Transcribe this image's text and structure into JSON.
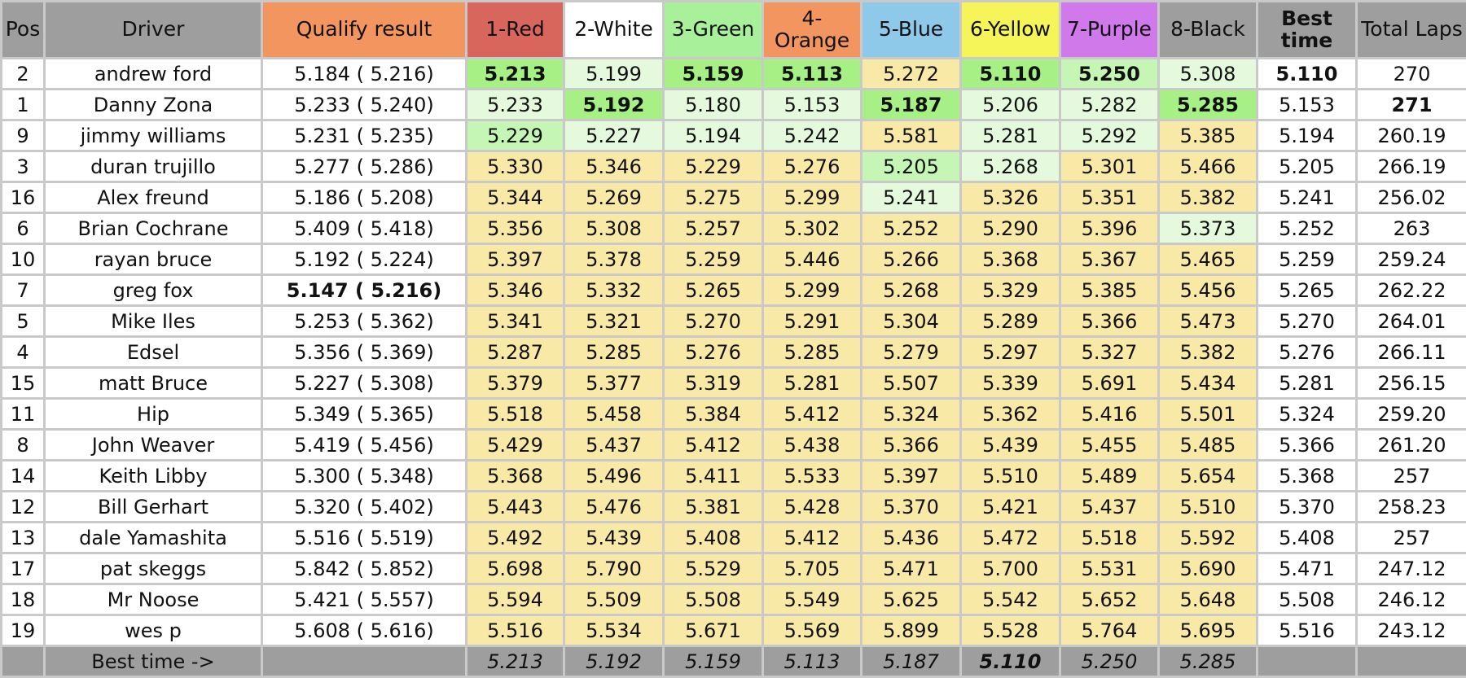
{
  "headers": [
    {
      "key": "pos",
      "label": "Pos",
      "bg": "#9e9e9e"
    },
    {
      "key": "driver",
      "label": "Driver",
      "bg": "#9e9e9e"
    },
    {
      "key": "qualify",
      "label": "Qualify result",
      "bg": "#f3955e"
    },
    {
      "key": "lane1",
      "label": "1-Red",
      "bg": "#d9665c"
    },
    {
      "key": "lane2",
      "label": "2-White",
      "bg": "#ffffff"
    },
    {
      "key": "lane3",
      "label": "3-Green",
      "bg": "#a9f09a"
    },
    {
      "key": "lane4",
      "label": "4-\nOrange",
      "bg": "#f3955e"
    },
    {
      "key": "lane5",
      "label": "5-Blue",
      "bg": "#8ec9ea"
    },
    {
      "key": "lane6",
      "label": "6-Yellow",
      "bg": "#f5f55a"
    },
    {
      "key": "lane7",
      "label": "7-Purple",
      "bg": "#cf79ea"
    },
    {
      "key": "lane8",
      "label": "8-Black",
      "bg": "#9e9e9e"
    },
    {
      "key": "best",
      "label": "Best\ntime",
      "bg": "#9e9e9e",
      "bold": true
    },
    {
      "key": "total",
      "label": "Total Laps",
      "bg": "#9e9e9e"
    }
  ],
  "cell_colors": {
    "y": "#f9e9a6",
    "g": "#a6f086",
    "l": "#c6f6b6",
    "p": "#e5fadc"
  },
  "rows": [
    {
      "pos": "2",
      "driver": "andrew ford",
      "qualify": "5.184 ( 5.216)",
      "lanes": [
        "5.213",
        "5.199",
        "5.159",
        "5.113",
        "5.272",
        "5.110",
        "5.250",
        "5.308"
      ],
      "bg": [
        "g",
        "p",
        "g",
        "g",
        "y",
        "g",
        "l",
        "p"
      ],
      "bold": [
        1,
        0,
        1,
        1,
        0,
        1,
        1,
        0
      ],
      "best": "5.110",
      "best_bold": true,
      "total": "270",
      "total_bold": false
    },
    {
      "pos": "1",
      "driver": "Danny Zona",
      "qualify": "5.233 ( 5.240)",
      "lanes": [
        "5.233",
        "5.192",
        "5.180",
        "5.153",
        "5.187",
        "5.206",
        "5.282",
        "5.285"
      ],
      "bg": [
        "p",
        "g",
        "p",
        "p",
        "g",
        "p",
        "p",
        "g"
      ],
      "bold": [
        0,
        1,
        0,
        0,
        1,
        0,
        0,
        1
      ],
      "best": "5.153",
      "best_bold": false,
      "total": "271",
      "total_bold": true
    },
    {
      "pos": "9",
      "driver": "jimmy williams",
      "qualify": "5.231 ( 5.235)",
      "lanes": [
        "5.229",
        "5.227",
        "5.194",
        "5.242",
        "5.581",
        "5.281",
        "5.292",
        "5.385"
      ],
      "bg": [
        "l",
        "p",
        "p",
        "p",
        "y",
        "p",
        "p",
        "y"
      ],
      "bold": [
        0,
        0,
        0,
        0,
        0,
        0,
        0,
        0
      ],
      "best": "5.194",
      "best_bold": false,
      "total": "260.19",
      "total_bold": false
    },
    {
      "pos": "3",
      "driver": "duran trujillo",
      "qualify": "5.277 ( 5.286)",
      "lanes": [
        "5.330",
        "5.346",
        "5.229",
        "5.276",
        "5.205",
        "5.268",
        "5.301",
        "5.466"
      ],
      "bg": [
        "y",
        "y",
        "y",
        "y",
        "l",
        "p",
        "y",
        "y"
      ],
      "bold": [
        0,
        0,
        0,
        0,
        0,
        0,
        0,
        0
      ],
      "best": "5.205",
      "best_bold": false,
      "total": "266.19",
      "total_bold": false
    },
    {
      "pos": "16",
      "driver": "Alex freund",
      "qualify": "5.186 ( 5.208)",
      "lanes": [
        "5.344",
        "5.269",
        "5.275",
        "5.299",
        "5.241",
        "5.326",
        "5.351",
        "5.382"
      ],
      "bg": [
        "y",
        "y",
        "y",
        "y",
        "p",
        "y",
        "y",
        "y"
      ],
      "bold": [
        0,
        0,
        0,
        0,
        0,
        0,
        0,
        0
      ],
      "best": "5.241",
      "best_bold": false,
      "total": "256.02",
      "total_bold": false
    },
    {
      "pos": "6",
      "driver": "Brian Cochrane",
      "qualify": "5.409 ( 5.418)",
      "lanes": [
        "5.356",
        "5.308",
        "5.257",
        "5.302",
        "5.252",
        "5.290",
        "5.396",
        "5.373"
      ],
      "bg": [
        "y",
        "y",
        "y",
        "y",
        "y",
        "y",
        "y",
        "p"
      ],
      "bold": [
        0,
        0,
        0,
        0,
        0,
        0,
        0,
        0
      ],
      "best": "5.252",
      "best_bold": false,
      "total": "263",
      "total_bold": false
    },
    {
      "pos": "10",
      "driver": "rayan bruce",
      "qualify": "5.192 ( 5.224)",
      "lanes": [
        "5.397",
        "5.378",
        "5.259",
        "5.446",
        "5.266",
        "5.368",
        "5.367",
        "5.465"
      ],
      "bg": [
        "y",
        "y",
        "y",
        "y",
        "y",
        "y",
        "y",
        "y"
      ],
      "bold": [
        0,
        0,
        0,
        0,
        0,
        0,
        0,
        0
      ],
      "best": "5.259",
      "best_bold": false,
      "total": "259.24",
      "total_bold": false
    },
    {
      "pos": "7",
      "driver": "greg fox",
      "qualify": "5.147 ( 5.216)",
      "qualify_bold": true,
      "lanes": [
        "5.346",
        "5.332",
        "5.265",
        "5.299",
        "5.268",
        "5.329",
        "5.385",
        "5.456"
      ],
      "bg": [
        "y",
        "y",
        "y",
        "y",
        "y",
        "y",
        "y",
        "y"
      ],
      "bold": [
        0,
        0,
        0,
        0,
        0,
        0,
        0,
        0
      ],
      "best": "5.265",
      "best_bold": false,
      "total": "262.22",
      "total_bold": false
    },
    {
      "pos": "5",
      "driver": "Mike Iles",
      "qualify": "5.253 ( 5.362)",
      "lanes": [
        "5.341",
        "5.321",
        "5.270",
        "5.291",
        "5.304",
        "5.289",
        "5.366",
        "5.473"
      ],
      "bg": [
        "y",
        "y",
        "y",
        "y",
        "y",
        "y",
        "y",
        "y"
      ],
      "bold": [
        0,
        0,
        0,
        0,
        0,
        0,
        0,
        0
      ],
      "best": "5.270",
      "best_bold": false,
      "total": "264.01",
      "total_bold": false
    },
    {
      "pos": "4",
      "driver": "Edsel",
      "qualify": "5.356 ( 5.369)",
      "lanes": [
        "5.287",
        "5.285",
        "5.276",
        "5.285",
        "5.279",
        "5.297",
        "5.327",
        "5.382"
      ],
      "bg": [
        "y",
        "y",
        "y",
        "y",
        "y",
        "y",
        "y",
        "y"
      ],
      "bold": [
        0,
        0,
        0,
        0,
        0,
        0,
        0,
        0
      ],
      "best": "5.276",
      "best_bold": false,
      "total": "266.11",
      "total_bold": false
    },
    {
      "pos": "15",
      "driver": "matt Bruce",
      "qualify": "5.227 ( 5.308)",
      "lanes": [
        "5.379",
        "5.377",
        "5.319",
        "5.281",
        "5.507",
        "5.339",
        "5.691",
        "5.434"
      ],
      "bg": [
        "y",
        "y",
        "y",
        "y",
        "y",
        "y",
        "y",
        "y"
      ],
      "bold": [
        0,
        0,
        0,
        0,
        0,
        0,
        0,
        0
      ],
      "best": "5.281",
      "best_bold": false,
      "total": "256.15",
      "total_bold": false
    },
    {
      "pos": "11",
      "driver": "Hip",
      "qualify": "5.349 ( 5.365)",
      "lanes": [
        "5.518",
        "5.458",
        "5.384",
        "5.412",
        "5.324",
        "5.362",
        "5.416",
        "5.501"
      ],
      "bg": [
        "y",
        "y",
        "y",
        "y",
        "y",
        "y",
        "y",
        "y"
      ],
      "bold": [
        0,
        0,
        0,
        0,
        0,
        0,
        0,
        0
      ],
      "best": "5.324",
      "best_bold": false,
      "total": "259.20",
      "total_bold": false
    },
    {
      "pos": "8",
      "driver": "John Weaver",
      "qualify": "5.419 ( 5.456)",
      "lanes": [
        "5.429",
        "5.437",
        "5.412",
        "5.438",
        "5.366",
        "5.439",
        "5.455",
        "5.485"
      ],
      "bg": [
        "y",
        "y",
        "y",
        "y",
        "y",
        "y",
        "y",
        "y"
      ],
      "bold": [
        0,
        0,
        0,
        0,
        0,
        0,
        0,
        0
      ],
      "best": "5.366",
      "best_bold": false,
      "total": "261.20",
      "total_bold": false
    },
    {
      "pos": "14",
      "driver": "Keith Libby",
      "qualify": "5.300 ( 5.348)",
      "lanes": [
        "5.368",
        "5.496",
        "5.411",
        "5.533",
        "5.397",
        "5.510",
        "5.489",
        "5.654"
      ],
      "bg": [
        "y",
        "y",
        "y",
        "y",
        "y",
        "y",
        "y",
        "y"
      ],
      "bold": [
        0,
        0,
        0,
        0,
        0,
        0,
        0,
        0
      ],
      "best": "5.368",
      "best_bold": false,
      "total": "257",
      "total_bold": false
    },
    {
      "pos": "12",
      "driver": "Bill Gerhart",
      "qualify": "5.320 ( 5.402)",
      "lanes": [
        "5.443",
        "5.476",
        "5.381",
        "5.428",
        "5.370",
        "5.421",
        "5.437",
        "5.510"
      ],
      "bg": [
        "y",
        "y",
        "y",
        "y",
        "y",
        "y",
        "y",
        "y"
      ],
      "bold": [
        0,
        0,
        0,
        0,
        0,
        0,
        0,
        0
      ],
      "best": "5.370",
      "best_bold": false,
      "total": "258.23",
      "total_bold": false
    },
    {
      "pos": "13",
      "driver": "dale Yamashita",
      "qualify": "5.516 ( 5.519)",
      "lanes": [
        "5.492",
        "5.439",
        "5.408",
        "5.412",
        "5.436",
        "5.472",
        "5.518",
        "5.592"
      ],
      "bg": [
        "y",
        "y",
        "y",
        "y",
        "y",
        "y",
        "y",
        "y"
      ],
      "bold": [
        0,
        0,
        0,
        0,
        0,
        0,
        0,
        0
      ],
      "best": "5.408",
      "best_bold": false,
      "total": "257",
      "total_bold": false
    },
    {
      "pos": "17",
      "driver": "pat skeggs",
      "qualify": "5.842 ( 5.852)",
      "lanes": [
        "5.698",
        "5.790",
        "5.529",
        "5.705",
        "5.471",
        "5.700",
        "5.531",
        "5.690"
      ],
      "bg": [
        "y",
        "y",
        "y",
        "y",
        "y",
        "y",
        "y",
        "y"
      ],
      "bold": [
        0,
        0,
        0,
        0,
        0,
        0,
        0,
        0
      ],
      "best": "5.471",
      "best_bold": false,
      "total": "247.12",
      "total_bold": false
    },
    {
      "pos": "18",
      "driver": "Mr Noose",
      "qualify": "5.421 ( 5.557)",
      "lanes": [
        "5.594",
        "5.509",
        "5.508",
        "5.549",
        "5.625",
        "5.542",
        "5.652",
        "5.648"
      ],
      "bg": [
        "y",
        "y",
        "y",
        "y",
        "y",
        "y",
        "y",
        "y"
      ],
      "bold": [
        0,
        0,
        0,
        0,
        0,
        0,
        0,
        0
      ],
      "best": "5.508",
      "best_bold": false,
      "total": "246.12",
      "total_bold": false
    },
    {
      "pos": "19",
      "driver": "wes p",
      "qualify": "5.608 ( 5.616)",
      "lanes": [
        "5.516",
        "5.534",
        "5.671",
        "5.569",
        "5.899",
        "5.528",
        "5.764",
        "5.695"
      ],
      "bg": [
        "y",
        "y",
        "y",
        "y",
        "y",
        "y",
        "y",
        "y"
      ],
      "bold": [
        0,
        0,
        0,
        0,
        0,
        0,
        0,
        0
      ],
      "best": "5.516",
      "best_bold": false,
      "total": "243.12",
      "total_bold": false
    }
  ],
  "footer": {
    "label": "Best time ->",
    "lanes": [
      "5.213",
      "5.192",
      "5.159",
      "5.113",
      "5.187",
      "5.110",
      "5.250",
      "5.285"
    ],
    "bold": [
      0,
      0,
      0,
      0,
      0,
      1,
      0,
      0
    ]
  }
}
